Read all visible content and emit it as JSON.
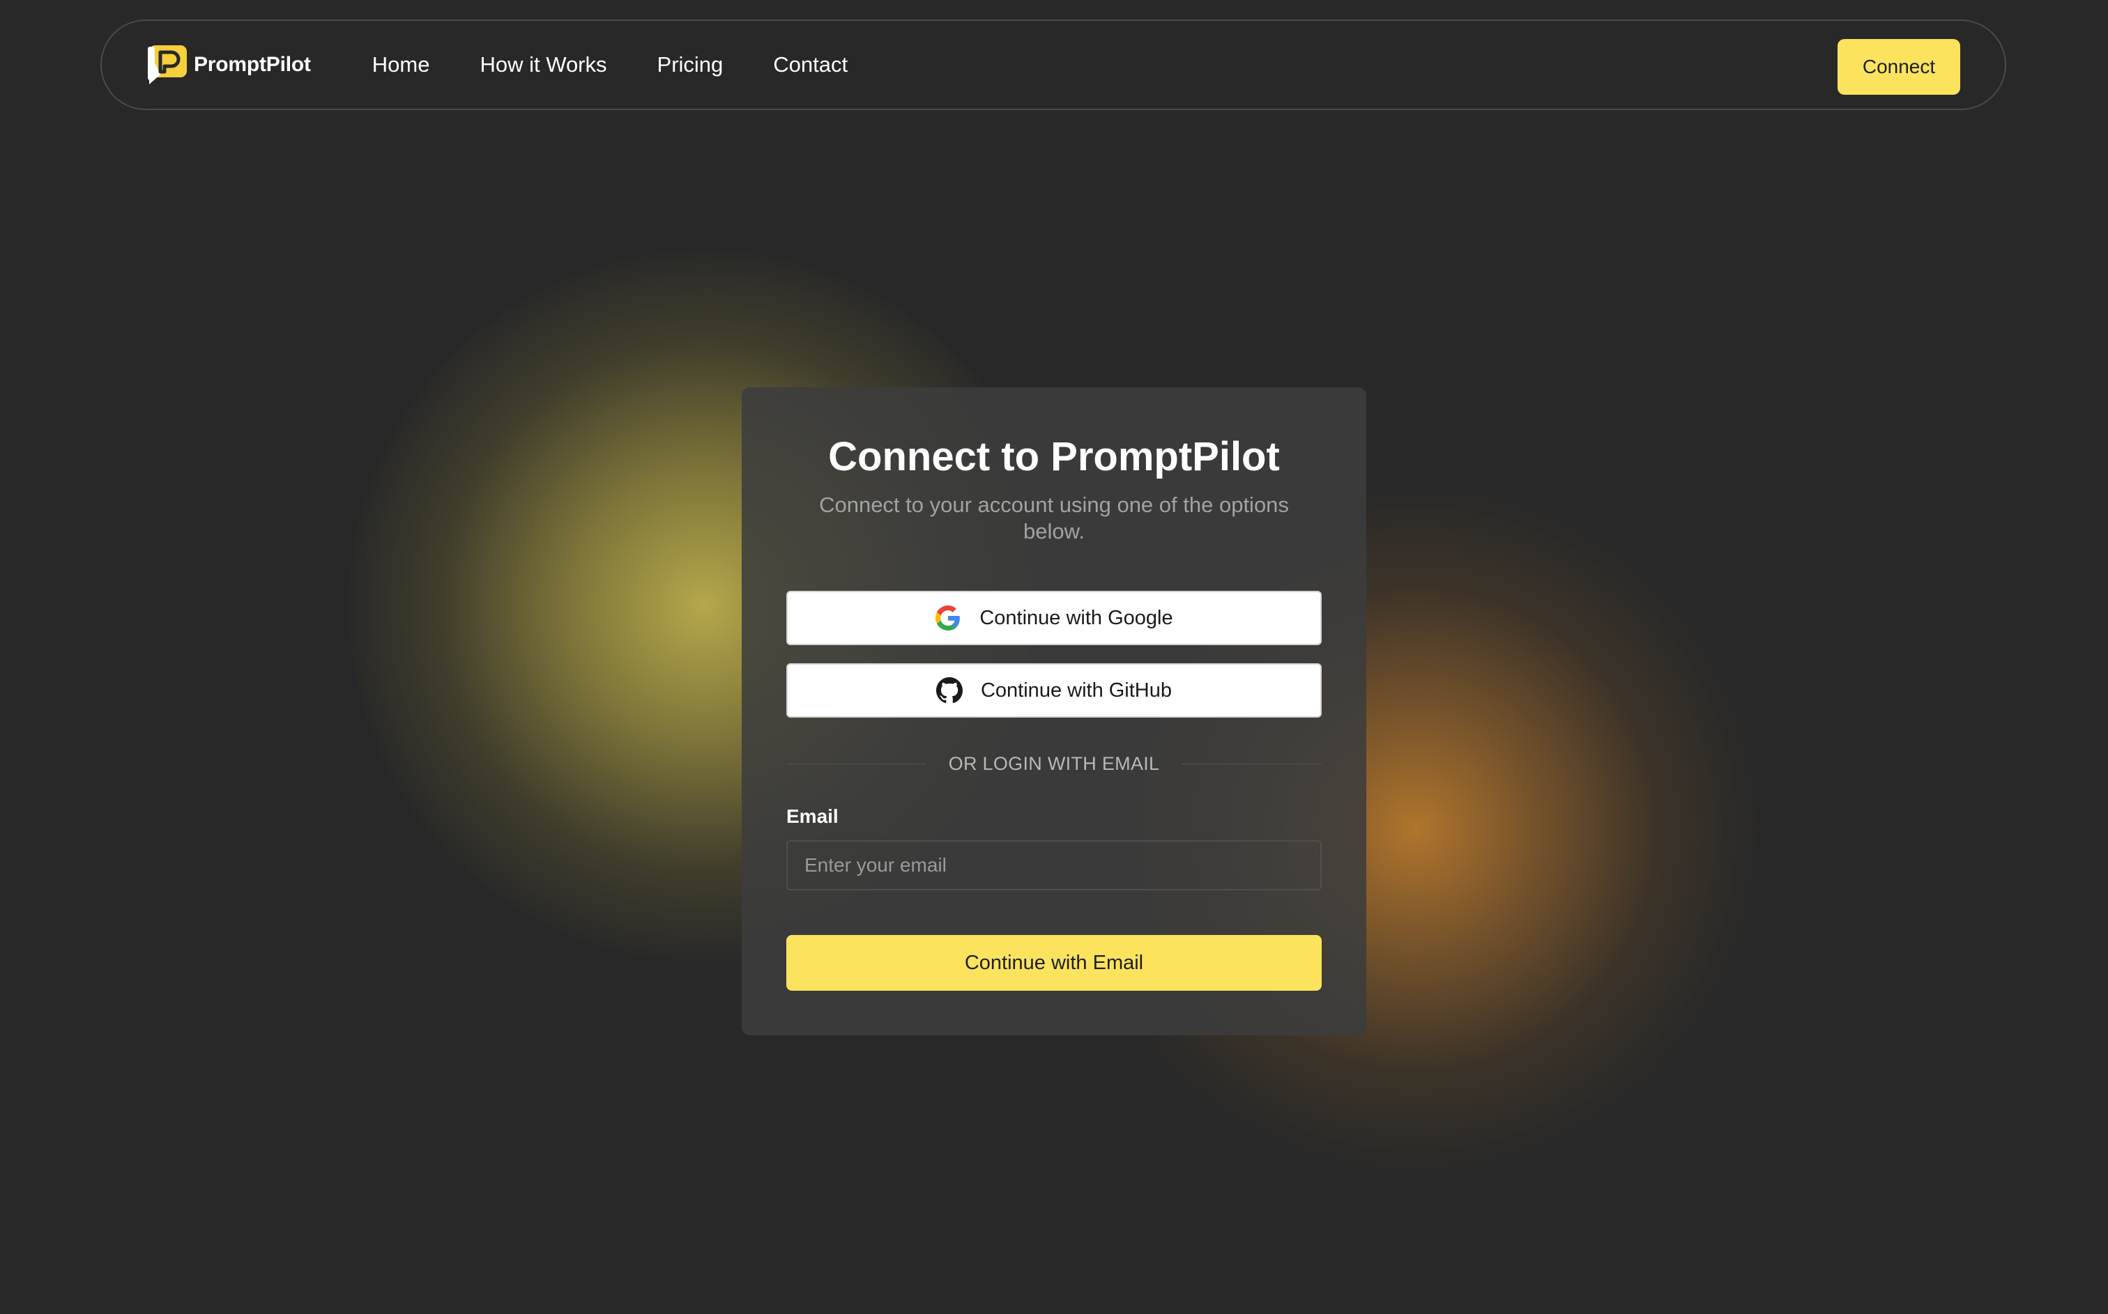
{
  "brand": {
    "name": "PromptPilot",
    "logo_icon": "promptpilot-logo-icon",
    "accent_color": "#fbe35e"
  },
  "nav": {
    "links": [
      {
        "label": "Home"
      },
      {
        "label": "How it Works"
      },
      {
        "label": "Pricing"
      },
      {
        "label": "Contact"
      }
    ],
    "connect_label": "Connect"
  },
  "card": {
    "title": "Connect to PromptPilot",
    "subtitle": "Connect to your account using one of the options below.",
    "google_label": "Continue with Google",
    "google_icon": "google-icon",
    "github_label": "Continue with GitHub",
    "github_icon": "github-icon",
    "divider_text": "OR LOGIN WITH EMAIL",
    "email_label": "Email",
    "email_placeholder": "Enter your email",
    "email_value": "",
    "submit_label": "Continue with Email"
  },
  "colors": {
    "background": "#282828",
    "card_background": "#3c3c3c",
    "glow_left": "#cdbe50",
    "glow_right": "#c8822d"
  }
}
